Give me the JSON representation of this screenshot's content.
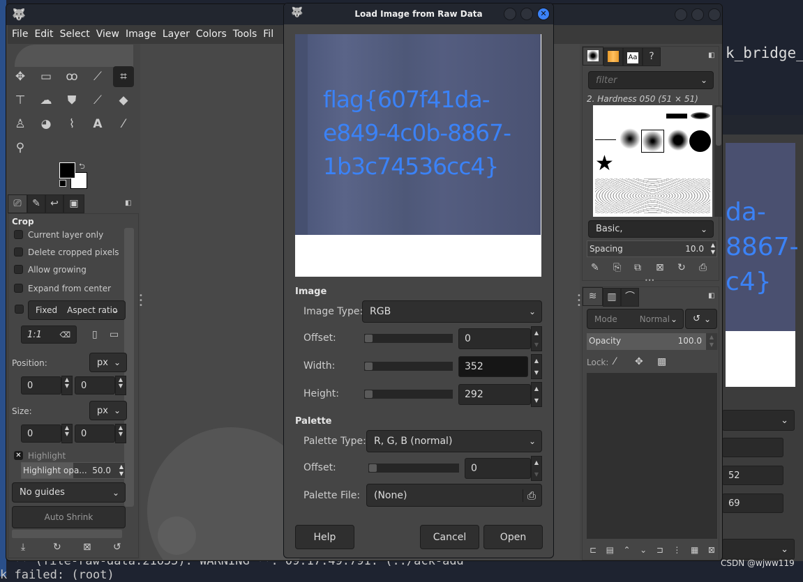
{
  "desktop": {
    "terminal_text_right": "k_bridge_a",
    "terminal_bottom_line1": "** (file-raw-data:21655): WARNING **: 09:17:49.791: (../ack-add",
    "terminal_bottom_line2": "k failed: (root)",
    "watermark": "CSDN @wjww119",
    "bg_window": {
      "flag_line1": "da-",
      "flag_line2": "8867-",
      "flag_line3": "c4}",
      "width_value": "52",
      "height_value": "69"
    }
  },
  "gimp": {
    "menu": [
      "File",
      "Edit",
      "Select",
      "View",
      "Image",
      "Layer",
      "Colors",
      "Tools",
      "Fil"
    ],
    "tools": [
      [
        "move-icon",
        "rect-select-icon",
        "lasso-icon",
        "fuzzy-select-icon",
        "crop-icon"
      ],
      [
        "unified-transform-icon",
        "warp-icon",
        "bucket-fill-icon",
        "paintbrush-icon",
        "eraser-icon"
      ],
      [
        "clone-icon",
        "smudge-icon",
        "paths-icon",
        "text-icon",
        "color-picker-icon"
      ],
      [
        "zoom-icon"
      ]
    ],
    "tool_options": {
      "title": "Crop",
      "current_layer_only": "Current layer only",
      "delete_cropped": "Delete cropped pixels",
      "allow_growing": "Allow growing",
      "expand_center": "Expand from center",
      "fixed": "Fixed",
      "fixed_mode": "Aspect ratio",
      "ratio": "1:1",
      "position_label": "Position:",
      "position_unit": "px",
      "position_x": "0",
      "position_y": "0",
      "size_label": "Size:",
      "size_unit": "px",
      "size_w": "0",
      "size_h": "0",
      "highlight": "Highlight",
      "highlight_opacity_label": "Highlight opa...",
      "highlight_opacity": "50.0",
      "highlight_opacity_percent": 50,
      "guides": "No guides",
      "auto_shrink": "Auto Shrink"
    },
    "brushes": {
      "filter_placeholder": "filter",
      "selected": "2. Hardness 050 (51 × 51)",
      "tag": "Basic,",
      "spacing_label": "Spacing",
      "spacing": "10.0"
    },
    "layers": {
      "mode_label": "Mode",
      "mode": "Normal",
      "opacity_label": "Opacity",
      "opacity": "100.0",
      "lock_label": "Lock:"
    }
  },
  "dialog": {
    "title": "Load Image from Raw Data",
    "preview_text": [
      "flag{607f41da-",
      "e849-4c0b-8867-",
      "1b3c74536cc4}"
    ],
    "image_section": "Image",
    "image_type_label": "Image Type:",
    "image_type": "RGB",
    "offset_label": "Offset:",
    "offset": "0",
    "width_label": "Width:",
    "width": "352",
    "height_label": "Height:",
    "height": "292",
    "palette_section": "Palette",
    "palette_type_label": "Palette Type:",
    "palette_type": "R, G, B (normal)",
    "palette_offset_label": "Offset:",
    "palette_offset": "0",
    "palette_file_label": "Palette File:",
    "palette_file": "(None)",
    "help": "Help",
    "cancel": "Cancel",
    "open": "Open",
    "accent": "#3b82f6"
  }
}
